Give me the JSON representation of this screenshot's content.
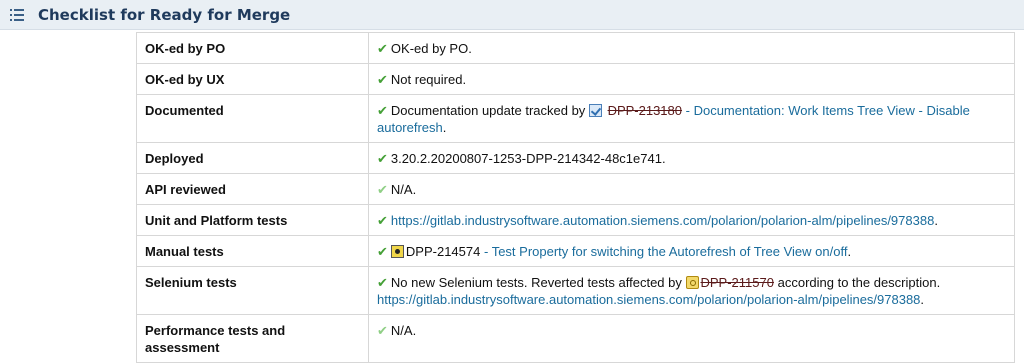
{
  "section": {
    "title": "Checklist for Ready for Merge",
    "icon": "list-icon"
  },
  "rows": [
    {
      "name": "OK-ed by PO",
      "value": "OK-ed by PO."
    },
    {
      "name": "OK-ed by UX",
      "value": "Not required."
    },
    {
      "name": "Documented",
      "prefix": "Documentation update tracked by",
      "item_id": "DPP-213180",
      "link_text": "- Documentation: Work Items Tree View - Disable autorefresh",
      "suffix": "."
    },
    {
      "name": "Deployed",
      "value": "3.20.2.20200807-1253-DPP-214342-48c1e741."
    },
    {
      "name": "API reviewed",
      "value": "N/A."
    },
    {
      "name": "Unit and Platform tests",
      "url": "https://gitlab.industrysoftware.automation.siemens.com/polarion/polarion-alm/pipelines/978388",
      "suffix": "."
    },
    {
      "name": "Manual tests",
      "item_id": "DPP-214574",
      "link_text": "- Test Property for switching the Autorefresh of Tree View on/off",
      "suffix": "."
    },
    {
      "name": "Selenium tests",
      "prefix": "No new Selenium tests. Reverted tests affected by",
      "item_id": "DPP-211570",
      "middle": "according to the description.",
      "url": "https://gitlab.industrysoftware.automation.siemens.com/polarion/polarion-alm/pipelines/978388",
      "suffix": "."
    },
    {
      "name": "Performance tests and assessment",
      "value": "N/A."
    }
  ],
  "check_mark": "✔",
  "colors": {
    "check_green": "#44a036",
    "check_light": "#8fcf85",
    "link": "#1a6c9c",
    "header_bg": "#e9eff4",
    "title": "#1f3a5c"
  }
}
